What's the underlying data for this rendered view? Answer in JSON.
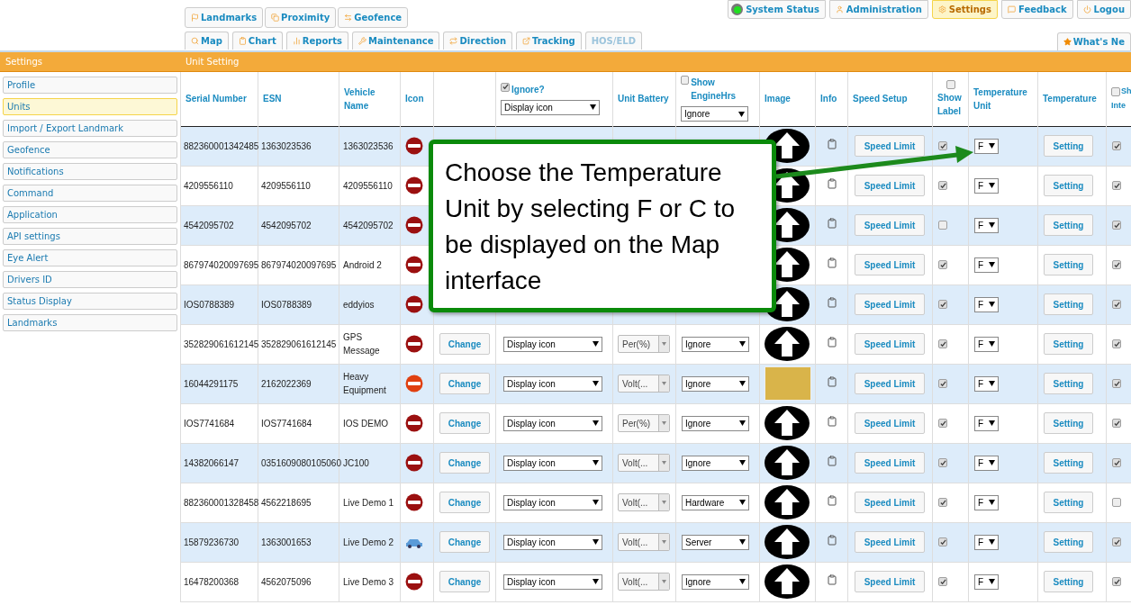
{
  "nav_row1": [
    {
      "label": "Landmarks"
    },
    {
      "label": "Proximity"
    },
    {
      "label": "Geofence"
    }
  ],
  "nav_row2": [
    {
      "label": "Map",
      "disabled": false
    },
    {
      "label": "Chart",
      "disabled": false
    },
    {
      "label": "Reports",
      "disabled": false
    },
    {
      "label": "Maintenance",
      "disabled": false
    },
    {
      "label": "Direction",
      "disabled": false
    },
    {
      "label": "Tracking",
      "disabled": false
    },
    {
      "label": "HOS/ELD",
      "disabled": true
    }
  ],
  "top_buttons": [
    {
      "label": "System Status",
      "selected": false
    },
    {
      "label": "Administration",
      "selected": false
    },
    {
      "label": "Settings",
      "selected": true
    },
    {
      "label": "Feedback",
      "selected": false
    },
    {
      "label": "Logou",
      "selected": false
    }
  ],
  "whats_new": "What's Ne",
  "sidebar": {
    "title": "Settings",
    "items": [
      {
        "label": "Profile",
        "selected": false
      },
      {
        "label": "Units",
        "selected": true
      },
      {
        "label": "Import / Export Landmark",
        "selected": false
      },
      {
        "label": "Geofence",
        "selected": false
      },
      {
        "label": "Notifications",
        "selected": false
      },
      {
        "label": "Command",
        "selected": false
      },
      {
        "label": "Application",
        "selected": false
      },
      {
        "label": "API settings",
        "selected": false
      },
      {
        "label": "Eye Alert",
        "selected": false
      },
      {
        "label": "Drivers ID",
        "selected": false
      },
      {
        "label": "Status Display",
        "selected": false
      },
      {
        "label": "Landmarks",
        "selected": false
      }
    ]
  },
  "panel_title": "Unit Setting",
  "columns": [
    {
      "kind": "text",
      "label": "Serial Number"
    },
    {
      "kind": "text",
      "label": "ESN"
    },
    {
      "kind": "text",
      "label": "Vehicle Name"
    },
    {
      "kind": "text",
      "label": "Icon"
    },
    {
      "kind": "empty"
    },
    {
      "kind": "checkbox_select",
      "label": "Ignore?",
      "checked": true,
      "select": "Display icon"
    },
    {
      "kind": "text",
      "label": "Unit Battery"
    },
    {
      "kind": "checkbox_select",
      "label": "Show EngineHrs",
      "checked": false,
      "select": "Ignore"
    },
    {
      "kind": "text",
      "label": "Image"
    },
    {
      "kind": "text",
      "label": "Info"
    },
    {
      "kind": "text",
      "label": "Speed Setup"
    },
    {
      "kind": "checkbox_below",
      "label": "Show Label",
      "checked": false
    },
    {
      "kind": "text",
      "label": "Temperature Unit"
    },
    {
      "kind": "text",
      "label": "Temperature"
    },
    {
      "kind": "checkbox_text",
      "label": "Sh",
      "label_2": "Inte",
      "checked": false
    }
  ],
  "rows": [
    {
      "serial": "882360001342485",
      "esn": "1363023536",
      "vehicle": "1363023536",
      "icon": {
        "kind": "red"
      },
      "image": {
        "kind": "arrow"
      },
      "speed_button": "Speed Limit",
      "show_label": true,
      "temp_unit": "F",
      "temperature_button": "Setting",
      "show_inter": true
    },
    {
      "serial": "4209556110",
      "esn": "4209556110",
      "vehicle": "4209556110",
      "icon": {
        "kind": "red"
      },
      "image": {
        "kind": "arrow"
      },
      "speed_button": "Speed Limit",
      "show_label": true,
      "temp_unit": "F",
      "temperature_button": "Setting",
      "show_inter": true
    },
    {
      "serial": "4542095702",
      "esn": "4542095702",
      "vehicle": "4542095702",
      "icon": {
        "kind": "red"
      },
      "image": {
        "kind": "arrow"
      },
      "speed_button": "Speed Limit",
      "show_label": false,
      "temp_unit": "F",
      "temperature_button": "Setting",
      "show_inter": true
    },
    {
      "serial": "867974020097695",
      "esn": "867974020097695",
      "vehicle": "Android 2",
      "icon": {
        "kind": "red"
      },
      "image": {
        "kind": "arrow"
      },
      "speed_button": "Speed Limit",
      "show_label": true,
      "temp_unit": "F",
      "temperature_button": "Setting",
      "show_inter": true
    },
    {
      "serial": "IOS0788389",
      "esn": "IOS0788389",
      "vehicle": "eddyios",
      "icon": {
        "kind": "red"
      },
      "image": {
        "kind": "arrow"
      },
      "speed_button": "Speed Limit",
      "show_label": true,
      "temp_unit": "F",
      "temperature_button": "Setting",
      "show_inter": true
    },
    {
      "serial": "352829061612145",
      "esn": "352829061612145",
      "vehicle": "GPS Message",
      "icon": {
        "kind": "red"
      },
      "change_button": "Change",
      "display": "Display icon",
      "battery": "Per(%)",
      "engine": "Ignore",
      "image": {
        "kind": "arrow"
      },
      "speed_button": "Speed Limit",
      "show_label": true,
      "temp_unit": "F",
      "temperature_button": "Setting",
      "show_inter": true
    },
    {
      "serial": "16044291175",
      "esn": "2162022369",
      "vehicle": "Heavy Equipment",
      "icon": {
        "kind": "orange"
      },
      "change_button": "Change",
      "display": "Display icon",
      "battery": "Volt(...",
      "engine": "Ignore",
      "image": {
        "kind": "photo"
      },
      "speed_button": "Speed Limit",
      "show_label": true,
      "temp_unit": "F",
      "temperature_button": "Setting",
      "show_inter": true
    },
    {
      "serial": "IOS7741684",
      "esn": "IOS7741684",
      "vehicle": "IOS DEMO",
      "icon": {
        "kind": "red"
      },
      "change_button": "Change",
      "display": "Display icon",
      "battery": "Per(%)",
      "engine": "Ignore",
      "image": {
        "kind": "arrow"
      },
      "speed_button": "Speed Limit",
      "show_label": true,
      "temp_unit": "F",
      "temperature_button": "Setting",
      "show_inter": true
    },
    {
      "serial": "14382066147",
      "esn": "0351609080105060",
      "vehicle": "JC100",
      "icon": {
        "kind": "red"
      },
      "change_button": "Change",
      "display": "Display icon",
      "battery": "Volt(...",
      "engine": "Ignore",
      "image": {
        "kind": "arrow"
      },
      "speed_button": "Speed Limit",
      "show_label": true,
      "temp_unit": "F",
      "temperature_button": "Setting",
      "show_inter": true
    },
    {
      "serial": "882360001328458",
      "esn": "4562218695",
      "vehicle": "Live Demo 1",
      "icon": {
        "kind": "red"
      },
      "change_button": "Change",
      "display": "Display icon",
      "battery": "Volt(...",
      "engine": "Hardware",
      "image": {
        "kind": "arrow"
      },
      "speed_button": "Speed Limit",
      "show_label": true,
      "temp_unit": "F",
      "temperature_button": "Setting",
      "show_inter": false
    },
    {
      "serial": "15879236730",
      "esn": "1363001653",
      "vehicle": "Live Demo 2",
      "icon": {
        "kind": "car"
      },
      "change_button": "Change",
      "display": "Display icon",
      "battery": "Volt(...",
      "engine": "Server",
      "image": {
        "kind": "arrow"
      },
      "speed_button": "Speed Limit",
      "show_label": true,
      "temp_unit": "F",
      "temperature_button": "Setting",
      "show_inter": true
    },
    {
      "serial": "16478200368",
      "esn": "4562075096",
      "vehicle": "Live Demo 3",
      "icon": {
        "kind": "red"
      },
      "change_button": "Change",
      "display": "Display icon",
      "battery": "Volt(...",
      "engine": "Ignore",
      "image": {
        "kind": "arrow"
      },
      "speed_button": "Speed Limit",
      "show_label": true,
      "temp_unit": "F",
      "temperature_button": "Setting",
      "show_inter": true
    }
  ],
  "callout": "Choose the Temperature Unit by selecting F or C to be displayed on the Map interface"
}
